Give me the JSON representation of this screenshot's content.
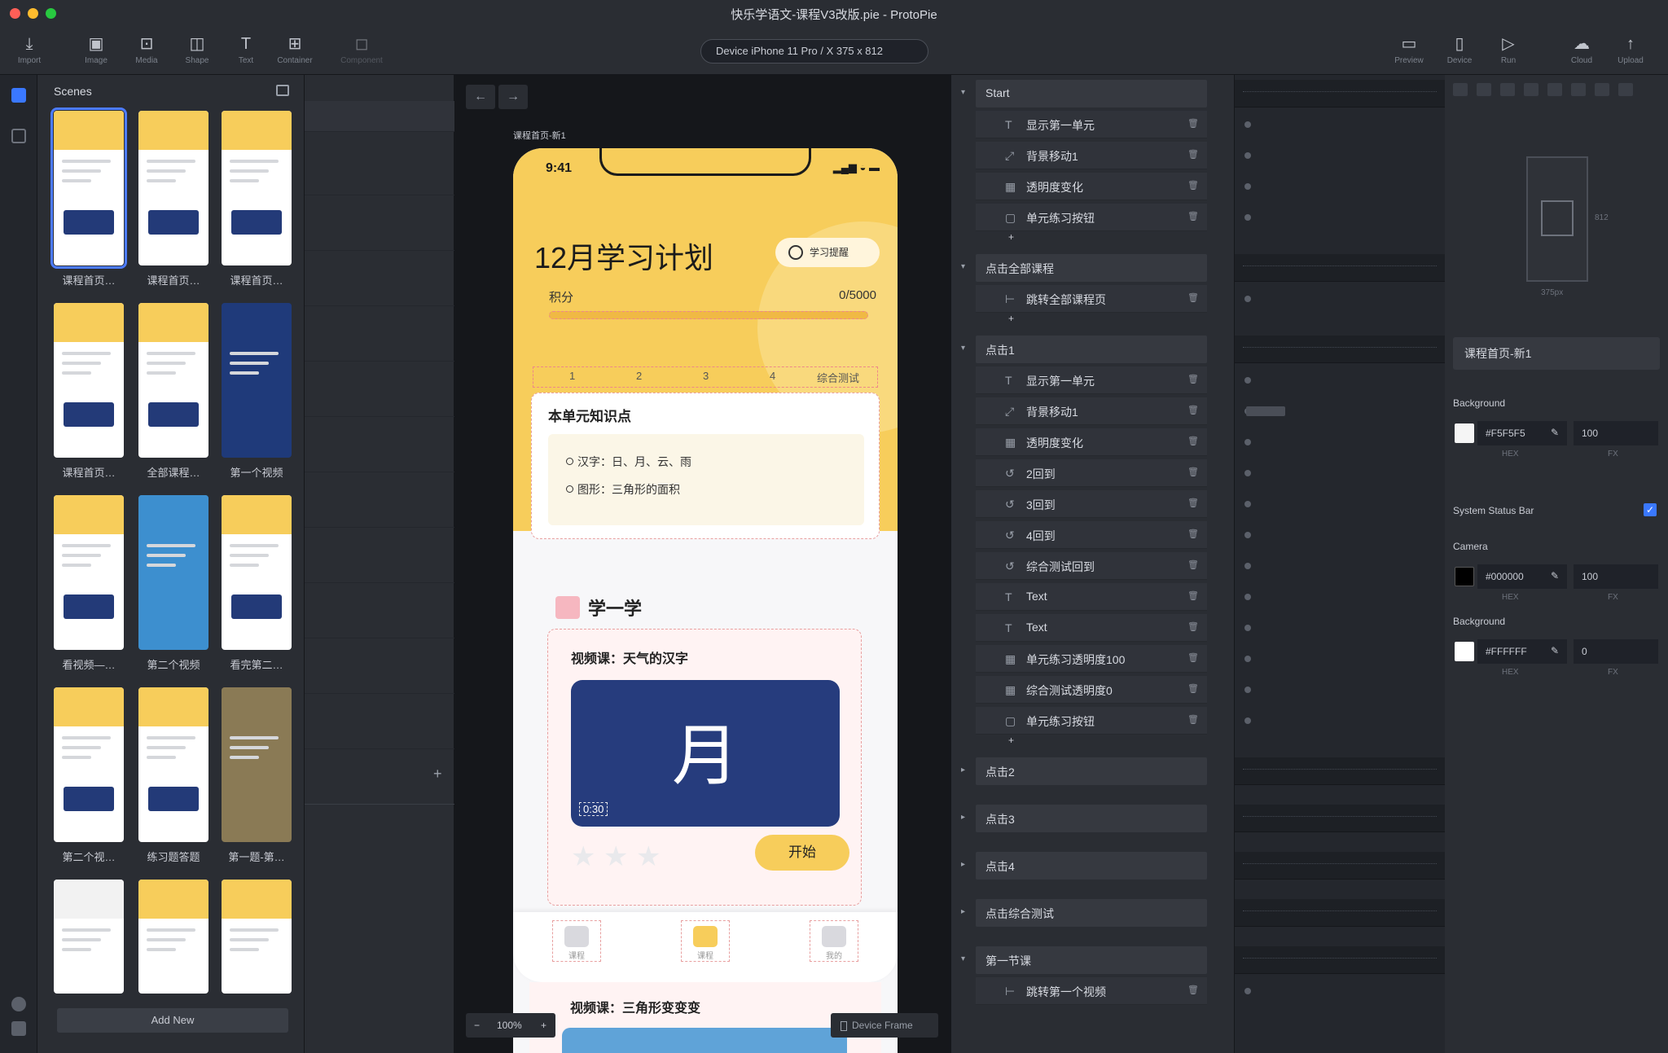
{
  "window": {
    "title": "快乐学语文-课程V3改版.pie - ProtoPie",
    "colors": {
      "close": "#ff5f57",
      "minimize": "#febc2e",
      "zoom": "#28c840"
    }
  },
  "toolbar": {
    "left_tools": [
      {
        "icon": "import-icon",
        "label": "Import"
      },
      {
        "icon": "image-icon",
        "label": "Image"
      },
      {
        "icon": "media-icon",
        "label": "Media"
      },
      {
        "icon": "shape-icon",
        "label": "Shape"
      },
      {
        "icon": "text-icon",
        "label": "Text"
      },
      {
        "icon": "container-icon",
        "label": "Container"
      },
      {
        "icon": "component-icon",
        "label": "Component"
      }
    ],
    "device": "Device   iPhone 11 Pro / X  375 x 812",
    "right_tools": [
      {
        "icon": "preview-icon",
        "label": "Preview"
      },
      {
        "icon": "device-icon",
        "label": "Device"
      },
      {
        "icon": "run-icon",
        "label": "Run"
      },
      {
        "icon": "cloud-icon",
        "label": "Cloud"
      },
      {
        "icon": "upload-icon",
        "label": "Upload"
      }
    ]
  },
  "scenes": {
    "header": "Scenes",
    "items": [
      "课程首页…",
      "课程首页…",
      "课程首页…",
      "课程首页…",
      "全部课程…",
      "第一个视频",
      "看视频—…",
      "第二个视频",
      "看完第二…",
      "第二个视…",
      "练习题答题",
      "第一题-第…",
      "",
      "",
      ""
    ],
    "add_new": "Add New"
  },
  "canvas": {
    "frame_label": "课程首页-新1",
    "zoom": "100%",
    "device_frame": "Device Frame",
    "phone": {
      "time": "9:41",
      "status_icons": "▂▄▆ ◒ ▬",
      "title": "12月学习计划",
      "pill": "学习提醒",
      "score_label": "积分",
      "score_value": "0/5000",
      "progress": 0.0,
      "steps": [
        "1",
        "2",
        "3",
        "4",
        "综合测试"
      ],
      "summary_title": "本单元知识点",
      "bullets": [
        "汉字：日、月、云、雨",
        "图形：三角形的面积"
      ],
      "learn_heading": "学一学",
      "video_title": "视频课：天气的汉字",
      "video_glyph": "月",
      "video_duration": "0:30",
      "rating": 0,
      "start_button": "开始",
      "tabs": [
        "课程",
        "课程",
        "我的"
      ],
      "below_title": "视频课：三角形变变变"
    }
  },
  "interactions": {
    "groups": [
      {
        "name": "Start",
        "actions": [
          {
            "name": "显示第一单元",
            "icon": "text-icon"
          },
          {
            "name": "背景移动1",
            "icon": "move-icon"
          },
          {
            "name": "透明度变化",
            "icon": "opacity-icon"
          },
          {
            "name": "单元练习按钮",
            "icon": "frame-icon"
          }
        ]
      },
      {
        "name": "点击全部课程",
        "actions": [
          {
            "name": "跳转全部课程页",
            "icon": "jump-icon"
          }
        ]
      },
      {
        "name": "点击1",
        "actions": [
          {
            "name": "显示第一单元",
            "icon": "text-icon"
          },
          {
            "name": "背景移动1",
            "icon": "move-icon"
          },
          {
            "name": "透明度变化",
            "icon": "opacity-icon"
          },
          {
            "name": "2回到",
            "icon": "reset-icon"
          },
          {
            "name": "3回到",
            "icon": "reset-icon"
          },
          {
            "name": "4回到",
            "icon": "reset-icon"
          },
          {
            "name": "综合测试回到",
            "icon": "reset-icon"
          },
          {
            "name": "Text",
            "icon": "text-icon"
          },
          {
            "name": "Text",
            "icon": "text-icon"
          },
          {
            "name": "单元练习透明度100",
            "icon": "opacity-icon"
          },
          {
            "name": "综合测试透明度0",
            "icon": "opacity-icon"
          },
          {
            "name": "单元练习按钮",
            "icon": "frame-icon"
          }
        ]
      },
      {
        "name": "点击2",
        "actions": []
      },
      {
        "name": "点击3",
        "actions": []
      },
      {
        "name": "点击4",
        "actions": []
      },
      {
        "name": "点击综合测试",
        "actions": []
      },
      {
        "name": "第一节课",
        "actions": [
          {
            "name": "跳转第一个视频",
            "icon": "jump-icon"
          }
        ]
      }
    ]
  },
  "properties": {
    "preview_width": "375px",
    "preview_height": "812",
    "scene_name": "课程首页-新1",
    "background_label": "Background",
    "background_hex": "#F5F5F5",
    "background_opacity": "100",
    "status_bar_label": "System Status Bar",
    "status_bar_checked": true,
    "camera_label": "Camera",
    "camera_hex": "#000000",
    "camera_opacity": "100",
    "background2_label": "Background",
    "background2_hex": "#FFFFFF",
    "background2_opacity": "0",
    "hex_sub": "HEX",
    "opacity_sub": "FX"
  }
}
